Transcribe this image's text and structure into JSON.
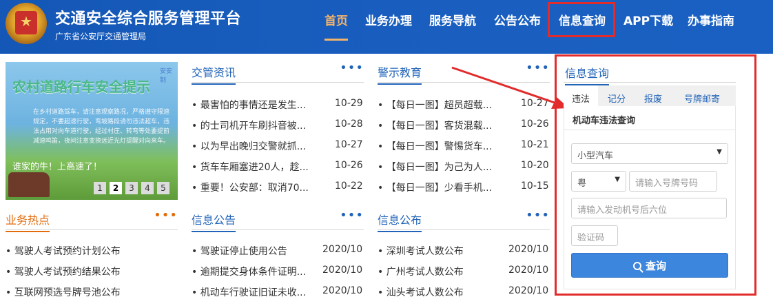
{
  "header": {
    "title": "交通安全综合服务管理平台",
    "subtitle": "广东省公安厅交通管理局",
    "nav": [
      "首页",
      "业务办理",
      "服务导航",
      "公告公布",
      "信息查询",
      "APP下载",
      "办事指南"
    ],
    "active_nav": "首页"
  },
  "banner": {
    "headline": "农村道路行车安全提示",
    "body": "在乡村道路驾车，请注意观察路况，严格遵守限速规定，不要超速行驶，弯坡路段请勿违法超车，违法占用对向车道行驶，经过村庄、转弯等处要提前减速鸣笛，夜间注意变换远近光灯提醒对向来车。",
    "caption": "谁家的牛！上高速了！",
    "tag": "安安制",
    "pages": [
      "1",
      "2",
      "3",
      "4",
      "5"
    ],
    "active_page": "2"
  },
  "news": {
    "title": "交管资讯",
    "more": "•••",
    "items": [
      {
        "text": "• 最害怕的事情还是发生...",
        "date": "10-29"
      },
      {
        "text": "• 的士司机开车刷抖音被...",
        "date": "10-28"
      },
      {
        "text": "• 以为早出晚归交警就抓...",
        "date": "10-27"
      },
      {
        "text": "• 货车车厢塞进20人，趁...",
        "date": "10-26"
      },
      {
        "text": "• 重要！公安部：取消70...",
        "date": "10-22"
      }
    ]
  },
  "warning": {
    "title": "警示教育",
    "more": "•••",
    "items": [
      {
        "text": "• 【每日一图】超员超载...",
        "date": "10-27"
      },
      {
        "text": "• 【每日一图】客货混载...",
        "date": "10-26"
      },
      {
        "text": "• 【每日一图】警惕货车...",
        "date": "10-21"
      },
      {
        "text": "• 【每日一图】为己为人...",
        "date": "10-20"
      },
      {
        "text": "• 【每日一图】少看手机...",
        "date": "10-15"
      }
    ]
  },
  "hot": {
    "title": "业务热点",
    "more": "•••",
    "items": [
      {
        "text": "• 驾驶人考试预约计划公布"
      },
      {
        "text": "• 驾驶人考试预约结果公布"
      },
      {
        "text": "• 互联网预选号牌号池公布"
      }
    ]
  },
  "notice": {
    "title": "信息公告",
    "more": "•••",
    "items": [
      {
        "text": "• 驾驶证停止使用公告",
        "date": "2020/10"
      },
      {
        "text": "• 逾期提交身体条件证明...",
        "date": "2020/10"
      },
      {
        "text": "• 机动车行驶证旧证未收...",
        "date": "2020/10"
      }
    ]
  },
  "publish": {
    "title": "信息公布",
    "more": "•••",
    "items": [
      {
        "text": "• 深圳考试人数公布",
        "date": "2020/10"
      },
      {
        "text": "• 广州考试人数公布",
        "date": "2020/10"
      },
      {
        "text": "• 汕头考试人数公布",
        "date": "2020/10"
      }
    ]
  },
  "query": {
    "title": "信息查询",
    "tabs": [
      "违法",
      "记分",
      "报废",
      "号牌邮寄"
    ],
    "active_tab": "违法",
    "form_title": "机动车违法查询",
    "vehicle_type": "小型汽车",
    "province": "粤",
    "plate_placeholder": "请输入号牌号码",
    "engine_placeholder": "请输入发动机号后六位",
    "captcha_placeholder": "验证码",
    "button": "查询"
  },
  "colors": {
    "header_bg": "#1a5fc0",
    "accent_blue": "#2163b8",
    "accent_orange": "#e26b0a",
    "highlight_red": "#e22b2b",
    "button_blue": "#3d86dd"
  }
}
